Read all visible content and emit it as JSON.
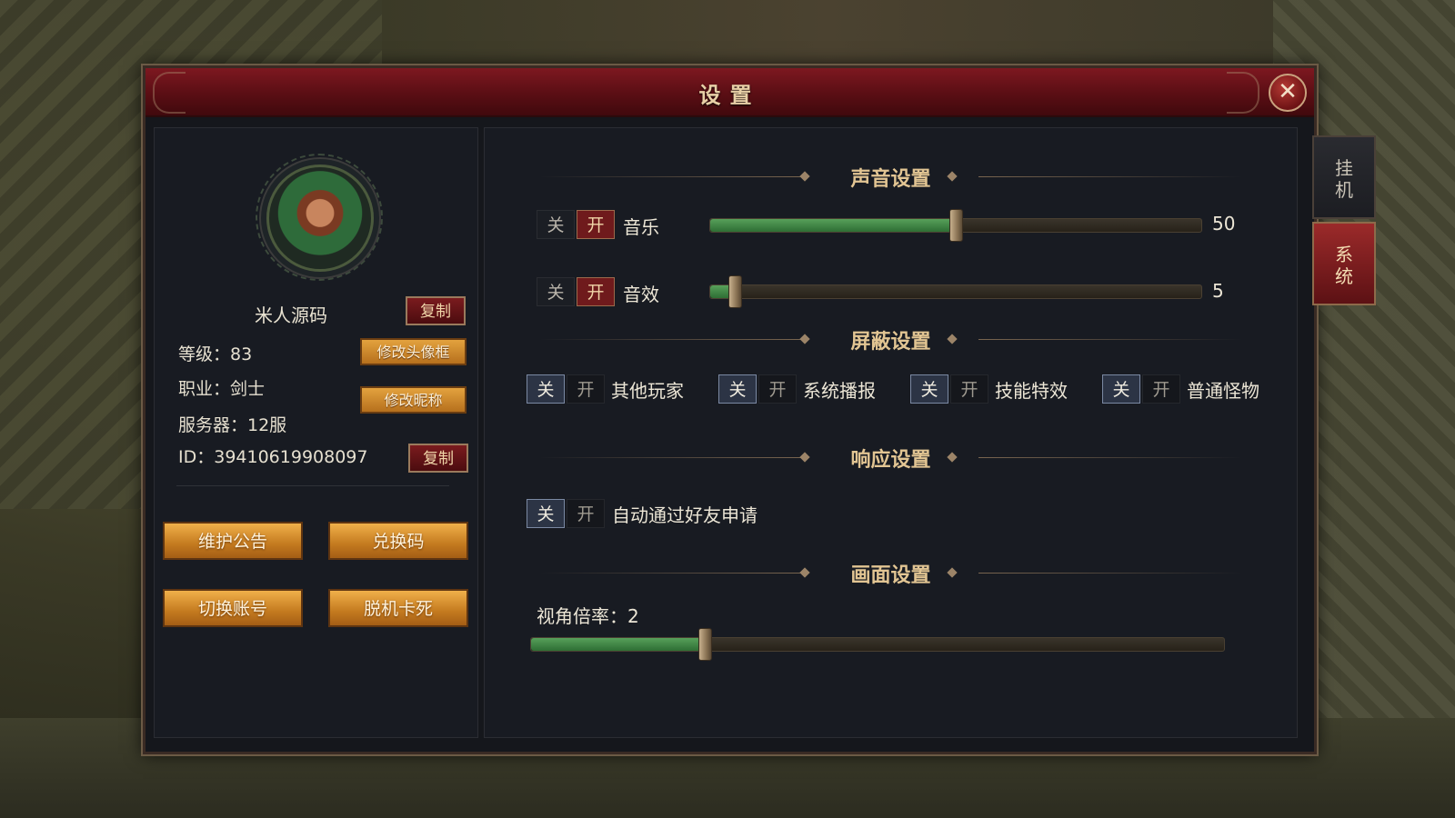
{
  "dialog": {
    "title": "设置",
    "close_label": "✕"
  },
  "profile": {
    "nickname": "米人源码",
    "copy_label": "复制",
    "level": "等级：83",
    "job": "职业：剑士",
    "server": "服务器：12服",
    "id": "ID：39410619908097",
    "change_avatar_label": "修改头像框",
    "change_nick_label": "修改昵称",
    "buttons": [
      "维护公告",
      "兑换码",
      "切换账号",
      "脱机卡死"
    ]
  },
  "sound": {
    "title": "声音设置",
    "rows": [
      {
        "off": "关",
        "on": "开",
        "label": "音乐",
        "value": 50,
        "value_text": "50"
      },
      {
        "off": "关",
        "on": "开",
        "label": "音效",
        "value": 5,
        "value_text": "5"
      }
    ]
  },
  "shield": {
    "title": "屏蔽设置",
    "items": [
      {
        "off": "关",
        "on": "开",
        "label": "其他玩家"
      },
      {
        "off": "关",
        "on": "开",
        "label": "系统播报"
      },
      {
        "off": "关",
        "on": "开",
        "label": "技能特效"
      },
      {
        "off": "关",
        "on": "开",
        "label": "普通怪物"
      }
    ]
  },
  "response": {
    "title": "响应设置",
    "item": {
      "off": "关",
      "on": "开",
      "label": "自动通过好友申请"
    }
  },
  "display": {
    "title": "画面设置",
    "zoom_label": "视角倍率：2",
    "zoom_level": 0.25
  },
  "side_tabs": [
    {
      "label": "挂机",
      "active": false
    },
    {
      "label": "系统",
      "active": true
    }
  ],
  "colors": {
    "accent_red": "#6f1a1c",
    "slider_green": "#57a05a",
    "gold_text": "#e2c593",
    "orange_button": "#e3a23e"
  }
}
